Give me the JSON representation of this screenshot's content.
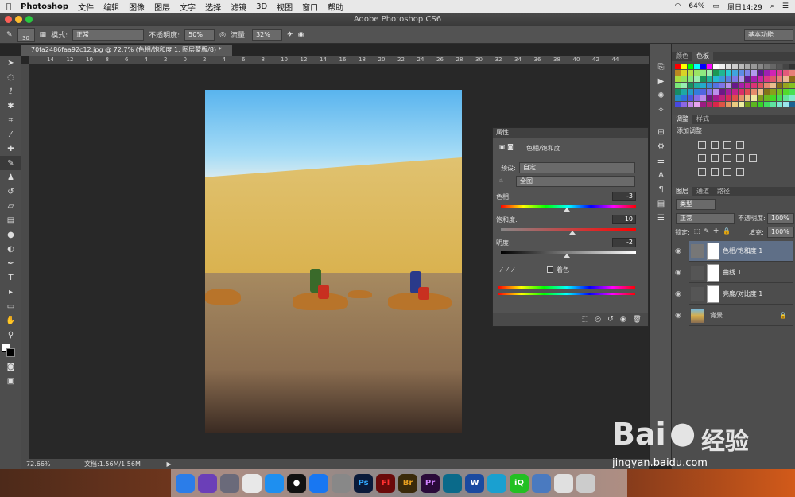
{
  "menubar": {
    "app": "Photoshop",
    "items": [
      "文件",
      "编辑",
      "图像",
      "图层",
      "文字",
      "选择",
      "滤镜",
      "3D",
      "视图",
      "窗口",
      "帮助"
    ],
    "battery": "64%",
    "clock": "周日14:29"
  },
  "window": {
    "title": "Adobe Photoshop CS6"
  },
  "options": {
    "brush_size": "30",
    "mode_label": "模式:",
    "mode_value": "正常",
    "opacity_label": "不透明度:",
    "opacity_value": "50%",
    "flow_label": "流量:",
    "flow_value": "32%",
    "workspace": "基本功能"
  },
  "document": {
    "tab": "70fa2486faa92c12.jpg @ 72.7% (色相/饱和度 1, 图层蒙版/8) *",
    "ruler_ticks": [
      "14",
      "12",
      "10",
      "8",
      "6",
      "4",
      "2",
      "0",
      "2",
      "4",
      "6",
      "8",
      "10",
      "12",
      "14",
      "16",
      "18",
      "20",
      "22",
      "24",
      "26",
      "28",
      "30",
      "32",
      "34",
      "36",
      "38",
      "40",
      "42",
      "44"
    ],
    "zoom": "72.66%",
    "docsize": "文档:1.56M/1.56M"
  },
  "properties": {
    "tab": "属性",
    "title": "色相/饱和度",
    "preset_label": "预设:",
    "preset_value": "自定",
    "channel_value": "全图",
    "hue_label": "色相:",
    "hue_value": "-3",
    "hue_pos": 0.49,
    "sat_label": "饱和度:",
    "sat_value": "+10",
    "sat_pos": 0.53,
    "light_label": "明度:",
    "light_value": "-2",
    "light_pos": 0.49,
    "colorize_label": "着色"
  },
  "panels": {
    "color_tabs": [
      "颜色",
      "色板"
    ],
    "adj_tabs": [
      "调整",
      "样式"
    ],
    "adj_title": "添加调整",
    "layer_tabs": [
      "图层",
      "通道",
      "路径"
    ],
    "kind": "类型",
    "blend": "正常",
    "opacity_label": "不透明度:",
    "opacity_value": "100%",
    "lock_label": "锁定:",
    "fill_label": "填充:",
    "fill_value": "100%"
  },
  "layers": [
    {
      "name": "色相/饱和度 1",
      "selected": true
    },
    {
      "name": "曲线 1",
      "selected": false
    },
    {
      "name": "亮度/对比度 1",
      "selected": false
    },
    {
      "name": "背景",
      "selected": false,
      "locked": true
    }
  ],
  "swatch_colors": [
    "#ff0000",
    "#ffff00",
    "#00ff00",
    "#00ffff",
    "#0000ff",
    "#ff00ff",
    "#ffffff",
    "#eeeeee",
    "#dddddd",
    "#cccccc",
    "#bbbbbb",
    "#aaaaaa",
    "#999999",
    "#888888",
    "#777777",
    "#666666",
    "#555555",
    "#444444",
    "#333333",
    "#000000"
  ],
  "dock": [
    "Finder",
    "Siri",
    "Launchpad",
    "Chrome",
    "Safari",
    "QQ",
    "AppStore",
    "Preferences",
    "Ps",
    "Fl",
    "Br",
    "Pr",
    "Edge",
    "Word",
    "Wunderlist",
    "iQIYI",
    "Xcode",
    "Preview",
    "Trash"
  ],
  "watermark": {
    "brand": "Bai",
    "brand2": "经验",
    "url": "jingyan.baidu.com"
  }
}
